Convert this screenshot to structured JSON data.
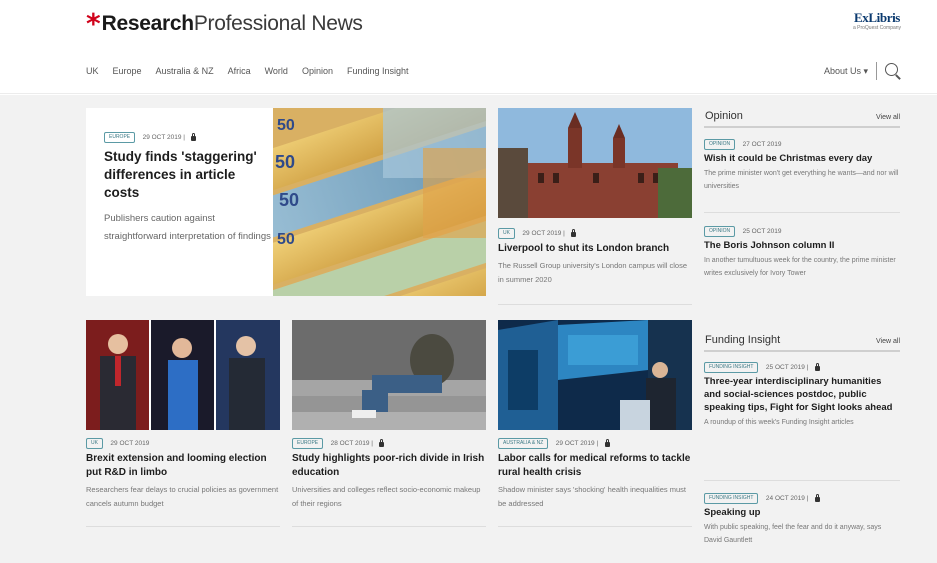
{
  "header": {
    "brand_asterisk": "*",
    "brand_bold": "Research",
    "brand_light": "Professional News",
    "partner_name": "ExLibris",
    "partner_tagline": "a ProQuest Company"
  },
  "nav": {
    "items": [
      "UK",
      "Europe",
      "Australia & NZ",
      "Africa",
      "World",
      "Opinion",
      "Funding Insight"
    ],
    "about": "About Us ▾"
  },
  "featured": {
    "tag": "Europe",
    "date": "29 OCT 2019 |",
    "headline": "Study finds 'staggering' differences in article costs",
    "standfirst": "Publishers caution against straightforward interpretation of findings"
  },
  "articles": [
    {
      "tag": "UK",
      "date": "29 OCT 2019 |",
      "headline": "Liverpool to shut its London branch",
      "standfirst": "The Russell Group university's London campus will close in summer 2020"
    },
    {
      "tag": "UK",
      "date": "29 OCT 2019",
      "headline": "Brexit extension and looming election put R&D in limbo",
      "standfirst": "Researchers fear delays to crucial policies as government cancels autumn budget"
    },
    {
      "tag": "Europe",
      "date": "28 OCT 2019 |",
      "headline": "Study highlights poor-rich divide in Irish education",
      "standfirst": "Universities and colleges reflect socio-economic makeup of their regions"
    },
    {
      "tag": "Australia & NZ",
      "date": "29 OCT 2019 |",
      "headline": "Labor calls for medical reforms to tackle rural health crisis",
      "standfirst": "Shadow minister says 'shocking' health inequalities must be addressed"
    }
  ],
  "opinion": {
    "title": "Opinion",
    "view_all": "View all",
    "items": [
      {
        "tag": "Opinion",
        "date": "27 OCT 2019",
        "headline": "Wish it could be Christmas every day",
        "standfirst": "The prime minister won't get everything he wants—and nor will universities"
      },
      {
        "tag": "Opinion",
        "date": "25 OCT 2019",
        "headline": "The Boris Johnson column II",
        "standfirst": "In another tumultuous week for the country, the prime minister writes exclusively for Ivory Tower"
      }
    ]
  },
  "funding": {
    "title": "Funding Insight",
    "view_all": "View all",
    "items": [
      {
        "tag": "Funding Insight",
        "date": "25 OCT 2019 |",
        "headline": "Three-year interdisciplinary humanities and social-sciences postdoc, public speaking tips, Fight for Sight looks ahead",
        "standfirst": "A roundup of this week's Funding Insight articles"
      },
      {
        "tag": "Funding Insight",
        "date": "24 OCT 2019 |",
        "headline": "Speaking up",
        "standfirst": "With public speaking, feel the fear and do it anyway, says David Gauntlett"
      }
    ]
  },
  "colors": {
    "brand_red": "#d0021b",
    "tag_teal": "#3d7a86",
    "page_bg": "#f2f2f2"
  }
}
